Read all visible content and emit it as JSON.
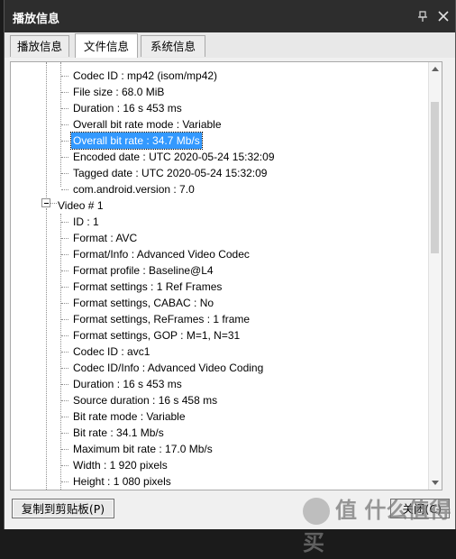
{
  "window": {
    "title": "播放信息"
  },
  "tabs": [
    {
      "label": "播放信息"
    },
    {
      "label": "文件信息"
    },
    {
      "label": "系统信息"
    }
  ],
  "tree": {
    "rows": [
      {
        "text": "Codec ID : mp42 (isom/mp42)"
      },
      {
        "text": "File size : 68.0 MiB"
      },
      {
        "text": "Duration : 16 s 453 ms"
      },
      {
        "text": "Overall bit rate mode : Variable"
      },
      {
        "text": "Overall bit rate : 34.7 Mb/s",
        "selected": true
      },
      {
        "text": "Encoded date : UTC 2020-05-24 15:32:09"
      },
      {
        "text": "Tagged date : UTC 2020-05-24 15:32:09"
      },
      {
        "text": "com.android.version : 7.0"
      },
      {
        "text": "Video # 1",
        "group": true
      },
      {
        "text": "ID : 1"
      },
      {
        "text": "Format : AVC"
      },
      {
        "text": "Format/Info : Advanced Video Codec"
      },
      {
        "text": "Format profile : Baseline@L4"
      },
      {
        "text": "Format settings : 1 Ref Frames"
      },
      {
        "text": "Format settings, CABAC : No"
      },
      {
        "text": "Format settings, ReFrames : 1 frame"
      },
      {
        "text": "Format settings, GOP : M=1, N=31"
      },
      {
        "text": "Codec ID : avc1"
      },
      {
        "text": "Codec ID/Info : Advanced Video Coding"
      },
      {
        "text": "Duration : 16 s 453 ms"
      },
      {
        "text": "Source duration : 16 s 458 ms"
      },
      {
        "text": "Bit rate mode : Variable"
      },
      {
        "text": "Bit rate : 34.1 Mb/s"
      },
      {
        "text": "Maximum bit rate : 17.0 Mb/s"
      },
      {
        "text": "Width : 1 920 pixels"
      },
      {
        "text": "Height : 1 080 pixels"
      }
    ]
  },
  "buttons": {
    "copy_label": "复制到剪贴板(P)",
    "close_label_partial": "关闭(C)"
  },
  "watermark": {
    "text": "值 什么值得买"
  }
}
